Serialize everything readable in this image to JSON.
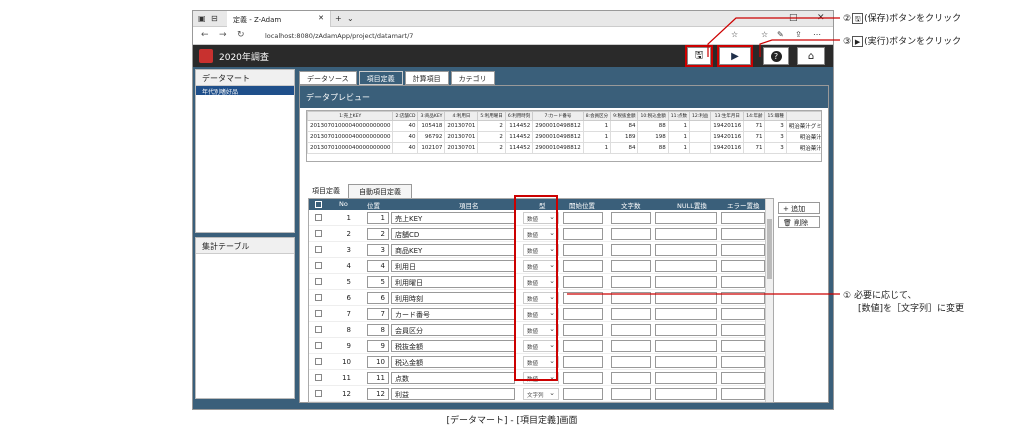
{
  "browser": {
    "tab_title": "定義 - Z-Adam",
    "url": "localhost:8080/zAdamApp/project/datamart/7"
  },
  "app": {
    "title": "2020年調査",
    "help_label": "?"
  },
  "sidebar": {
    "datamart_title": "データマート",
    "selected_item": "年代別嗜好品",
    "summary_title": "集計テーブル"
  },
  "tabs": [
    "データソース",
    "項目定義",
    "計算項目",
    "カテゴリ"
  ],
  "preview": {
    "title": "データプレビュー",
    "headers": [
      "1:売上KEY",
      "2:店舗CD",
      "3:商品KEY",
      "4:利用日",
      "5:利用曜日",
      "6:利用時刻",
      "7:カード番号",
      "8:会員区分",
      "9:税抜金額",
      "10:税込金額",
      "11:点数",
      "12:利益",
      "13:生年月日",
      "14:年齢",
      "15:職種"
    ],
    "rows": [
      [
        "20130701000040000000000",
        "40",
        "105418",
        "20130701",
        "2",
        "114452",
        "2900010498812",
        "1",
        "84",
        "88",
        "1",
        "",
        "19420116",
        "71",
        "3"
      ],
      [
        "20130701000040000000000",
        "40",
        "96792",
        "20130701",
        "2",
        "114452",
        "2900010498812",
        "1",
        "189",
        "198",
        "1",
        "",
        "19420116",
        "71",
        "3"
      ],
      [
        "20130701000040000000000",
        "40",
        "102107",
        "20130701",
        "2",
        "114452",
        "2900010498812",
        "1",
        "84",
        "88",
        "1",
        "",
        "19420116",
        "71",
        "3"
      ]
    ],
    "extra_col": [
      "明治菓汁グミミ",
      "明治菓汁グ",
      "明治菓汁グ"
    ]
  },
  "subtabs": {
    "item_def": "項目定義",
    "auto_def": "自動項目定義"
  },
  "grid": {
    "headers": {
      "no": "No",
      "pos": "位置",
      "name": "項目名",
      "type": "型",
      "start": "開始位置",
      "chars": "文字数",
      "null": "NULL置換",
      "err": "エラー置換"
    },
    "rows": [
      {
        "no": "1",
        "pos": "1",
        "name": "売上KEY",
        "type": "数値"
      },
      {
        "no": "2",
        "pos": "2",
        "name": "店舗CD",
        "type": "数値"
      },
      {
        "no": "3",
        "pos": "3",
        "name": "商品KEY",
        "type": "数値"
      },
      {
        "no": "4",
        "pos": "4",
        "name": "利用日",
        "type": "数値"
      },
      {
        "no": "5",
        "pos": "5",
        "name": "利用曜日",
        "type": "数値"
      },
      {
        "no": "6",
        "pos": "6",
        "name": "利用時刻",
        "type": "数値"
      },
      {
        "no": "7",
        "pos": "7",
        "name": "カード番号",
        "type": "数値"
      },
      {
        "no": "8",
        "pos": "8",
        "name": "会員区分",
        "type": "数値"
      },
      {
        "no": "9",
        "pos": "9",
        "name": "税抜金額",
        "type": "数値"
      },
      {
        "no": "10",
        "pos": "10",
        "name": "税込金額",
        "type": "数値"
      },
      {
        "no": "11",
        "pos": "11",
        "name": "点数",
        "type": "数値"
      },
      {
        "no": "12",
        "pos": "12",
        "name": "利益",
        "type": "文字列"
      }
    ],
    "add_label": "追加",
    "delete_label": "削除"
  },
  "callouts": {
    "save_pre": "②",
    "save_post": "(保存)ボタンをクリック",
    "run_pre": "③",
    "run_post": "(実行)ボタンをクリック",
    "change_num": "①",
    "change_l1": "必要に応じて、",
    "change_l2": "[数値]を［文字列］に変更"
  },
  "caption": "[データマート] - [項目定義]画面",
  "colors": {
    "accent": "#c00000",
    "header": "#3a5f7a",
    "selected": "#1f4f8a"
  }
}
